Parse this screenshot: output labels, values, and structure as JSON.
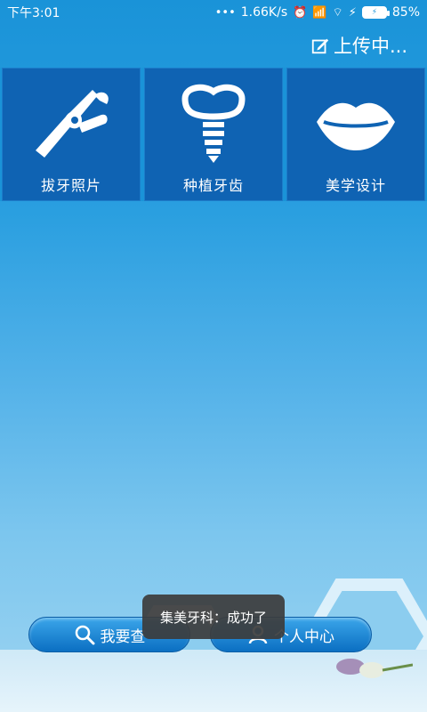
{
  "status_bar": {
    "time": "下午3:01",
    "dots": "•••",
    "speed": "1.66K/s",
    "signal_label": "HD",
    "battery": "85%"
  },
  "header": {
    "upload_label": "上传中..."
  },
  "tiles": [
    {
      "label": "拔牙照片",
      "icon": "extraction-pliers-icon"
    },
    {
      "label": "种植牙齿",
      "icon": "dental-implant-icon"
    },
    {
      "label": "美学设计",
      "icon": "lips-icon"
    }
  ],
  "bottom_buttons": {
    "search_label": "我要查",
    "profile_label": "个人中心"
  },
  "toast": {
    "message": "集美牙科：成功了"
  },
  "colors": {
    "tile_bg": "#0f63b3",
    "background_top": "#1a93d8",
    "pill": "#0b6fc2"
  }
}
